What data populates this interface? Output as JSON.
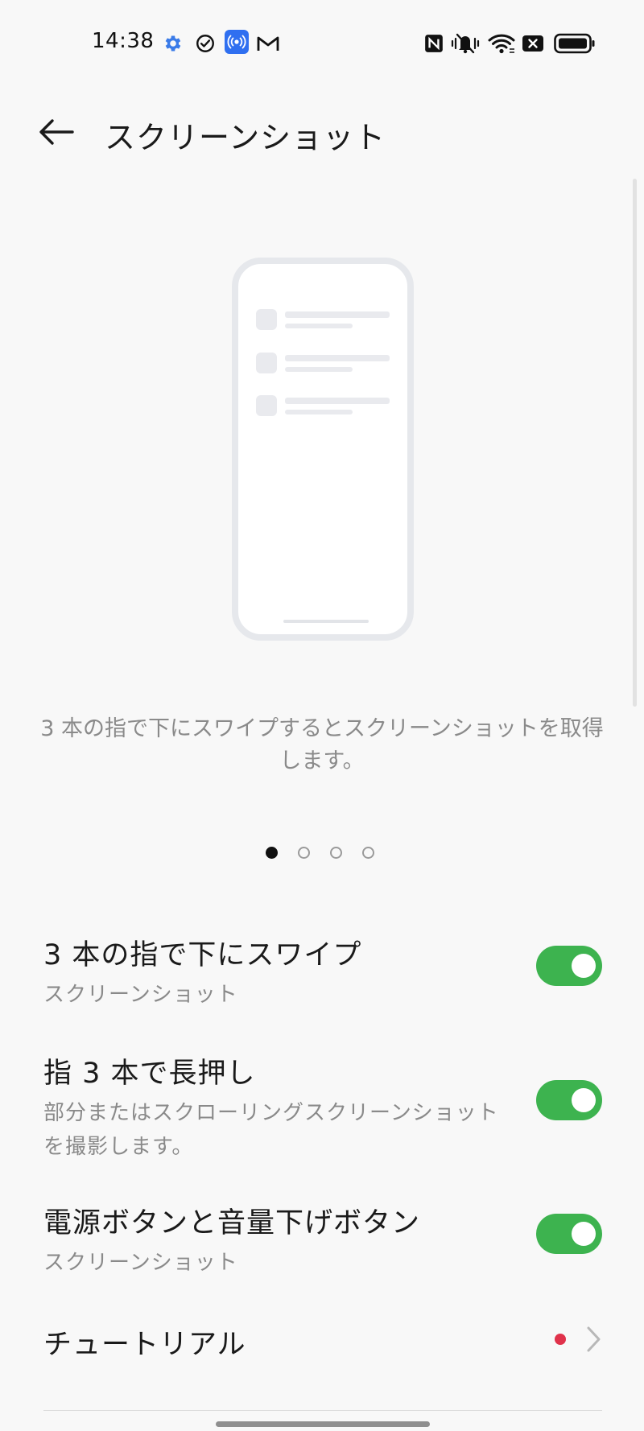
{
  "status_bar": {
    "time": "14:38",
    "icons_left": [
      "gear-icon",
      "check-circle-icon",
      "broadcast-icon",
      "gmail-icon"
    ],
    "icons_right": [
      "nfc-icon",
      "vibrate-mute-icon",
      "wifi-icon",
      "x-box-icon",
      "battery-icon"
    ]
  },
  "header": {
    "back_icon": "arrow-left-icon",
    "title": "スクリーンショット"
  },
  "illustration": {
    "caption": "3 本の指で下にスワイプするとスクリーンショットを取得します。",
    "page_count": 4,
    "active_page": 0
  },
  "settings": {
    "items": [
      {
        "title": "3 本の指で下にスワイプ",
        "subtitle": "スクリーンショット",
        "enabled": true
      },
      {
        "title": "指 3 本で長押し",
        "subtitle": "部分またはスクローリングスクリーンショットを撮影します。",
        "enabled": true
      },
      {
        "title": "電源ボタンと音量下げボタン",
        "subtitle": "スクリーンショット",
        "enabled": true
      }
    ],
    "tutorial": {
      "label": "チュートリアル",
      "has_badge": true
    }
  },
  "colors": {
    "toggle_on": "#3db34f",
    "badge": "#e0324b",
    "background": "#f8f8f8",
    "blue_accent": "#2f6ff0"
  }
}
